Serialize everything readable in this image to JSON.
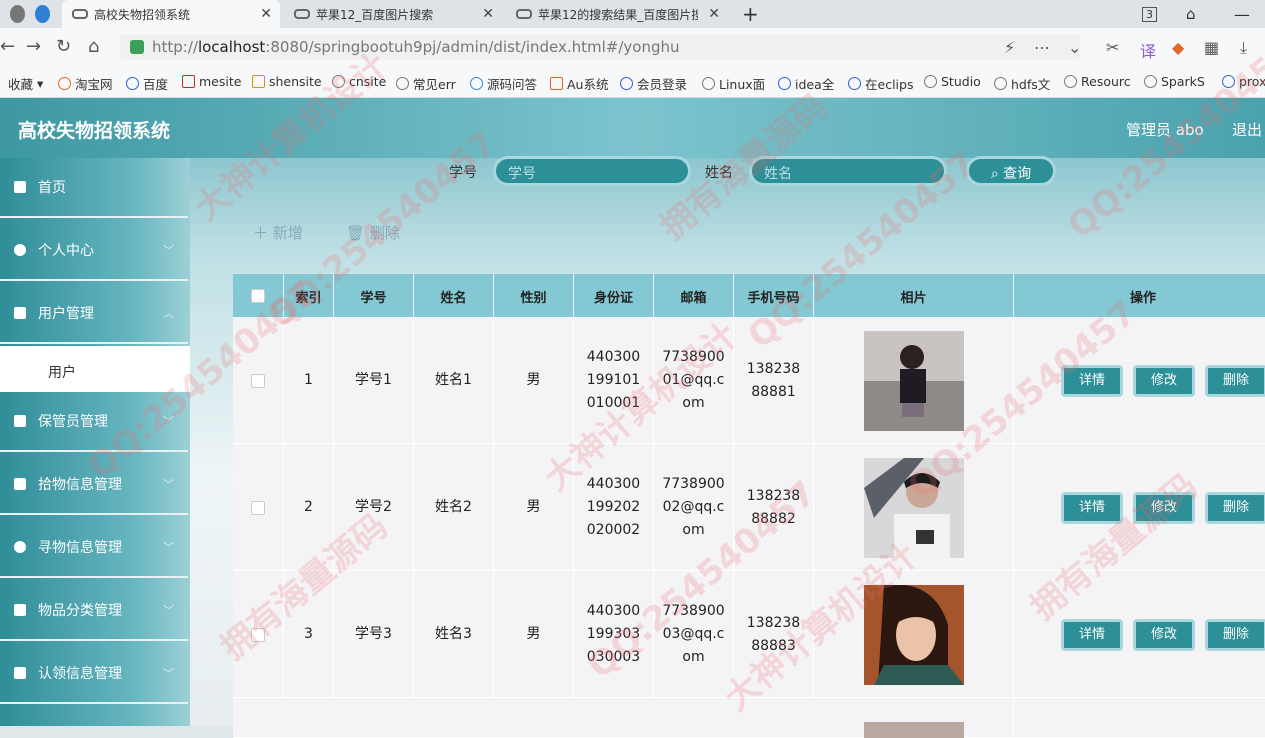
{
  "browser": {
    "tabs": [
      {
        "title": "高校失物招领系统"
      },
      {
        "title": "苹果12_百度图片搜索"
      },
      {
        "title": "苹果12的搜索结果_百度图片搜"
      }
    ],
    "url_prefix": "http://",
    "url_host": "localhost",
    "url_rest": ":8080/springbootuh9pj/admin/dist/index.html#/yonghu",
    "tab_counter": "3",
    "bookmarks": [
      "收藏",
      "淘宝网",
      "百度",
      "mesite",
      "shensite",
      "cnsite",
      "常见err",
      "源码问答",
      "Au系统",
      "会员登录",
      "Linux面",
      "idea全",
      "在eclips",
      "Studio",
      "hdfs文",
      "Resourc",
      "SparkS",
      "prox"
    ]
  },
  "header": {
    "title": "高校失物招领系统",
    "admin": "管理员 abo",
    "logout": "退出"
  },
  "sidebar": {
    "items": [
      {
        "label": "首页",
        "has_arrow": false
      },
      {
        "label": "个人中心",
        "has_arrow": true
      },
      {
        "label": "用户管理",
        "has_arrow": true
      },
      {
        "label": "保管员管理",
        "has_arrow": true
      },
      {
        "label": "拾物信息管理",
        "has_arrow": true
      },
      {
        "label": "寻物信息管理",
        "has_arrow": true
      },
      {
        "label": "物品分类管理",
        "has_arrow": true
      },
      {
        "label": "认领信息管理",
        "has_arrow": true
      }
    ],
    "submenu": "用户"
  },
  "search": {
    "xuehao_label": "学号",
    "xuehao_placeholder": "学号",
    "xingming_label": "姓名",
    "xingming_placeholder": "姓名",
    "query_button": "查询"
  },
  "actions": {
    "add": "新增",
    "delete": "删除"
  },
  "table": {
    "columns": [
      "索引",
      "学号",
      "姓名",
      "性别",
      "身份证",
      "邮箱",
      "手机号码",
      "相片",
      "操作"
    ],
    "rows": [
      {
        "index": "1",
        "xuehao": "学号1",
        "name": "姓名1",
        "gender": "男",
        "id": "440300199101010001",
        "email": "773890001@qq.com",
        "phone": "13823888881"
      },
      {
        "index": "2",
        "xuehao": "学号2",
        "name": "姓名2",
        "gender": "男",
        "id": "440300199202020002",
        "email": "773890002@qq.com",
        "phone": "13823888882"
      },
      {
        "index": "3",
        "xuehao": "学号3",
        "name": "姓名3",
        "gender": "男",
        "id": "440300199303030003",
        "email": "773890003@qq.com",
        "phone": "13823888883"
      }
    ],
    "btn_detail": "详情",
    "btn_edit": "修改",
    "btn_delete": "删除"
  },
  "watermarks": [
    "QQ:254540457",
    "大神计算机设计",
    "拥有海量源码"
  ],
  "colors": {
    "accent": "#2d8f97",
    "header": "#4aa2ad",
    "table_head": "#83c8d2"
  }
}
